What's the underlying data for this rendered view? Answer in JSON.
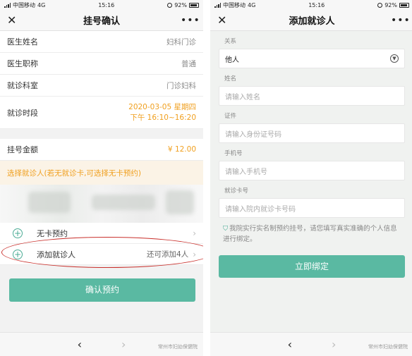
{
  "status": {
    "carrier": "中国移动",
    "network": "4G",
    "time": "15:16",
    "battery": "92%"
  },
  "left": {
    "title": "挂号确认",
    "rows": [
      {
        "label": "医生姓名",
        "value": "妇科门诊"
      },
      {
        "label": "医生职称",
        "value": "普通"
      },
      {
        "label": "就诊科室",
        "value": "门诊妇科"
      }
    ],
    "time_label": "就诊时段",
    "time_line1": "2020-03-05 星期四",
    "time_line2": "下午 16:10~16:20",
    "amount_label": "挂号金额",
    "amount_value": "¥ 12.00",
    "select_tip": "选择就诊人(若无就诊卡,可选择无卡预约)",
    "options": {
      "no_card": "无卡预约",
      "add_patient": "添加就诊人",
      "add_hint": "还可添加4人"
    },
    "confirm_button": "确认预约"
  },
  "right": {
    "title": "添加就诊人",
    "relation_label": "关系",
    "relation_value": "他人",
    "name_label": "姓名",
    "name_placeholder": "请输入姓名",
    "id_label": "证件",
    "id_placeholder": "请输入身份证号码",
    "phone_label": "手机号",
    "phone_placeholder": "请输入手机号",
    "card_label": "就诊卡号",
    "card_placeholder": "请输入院内就诊卡号码",
    "notice": "我院实行实名制预约挂号，请您填写真实准确的个人信息进行绑定。",
    "bind_button": "立即绑定"
  },
  "footer": {
    "brand": "常州市妇幼保健院"
  },
  "icons": {
    "close": "close-icon",
    "more": "more-icon",
    "plus": "plus-circle-icon",
    "chevron": "chevron-right-icon",
    "dropdown": "dropdown-circle-icon",
    "back": "back-arrow-icon",
    "forward": "forward-arrow-icon",
    "shield": "shield-icon"
  },
  "colors": {
    "accent": "#5ab9a2",
    "orange": "#f0a020",
    "annotation": "#c9302c"
  }
}
